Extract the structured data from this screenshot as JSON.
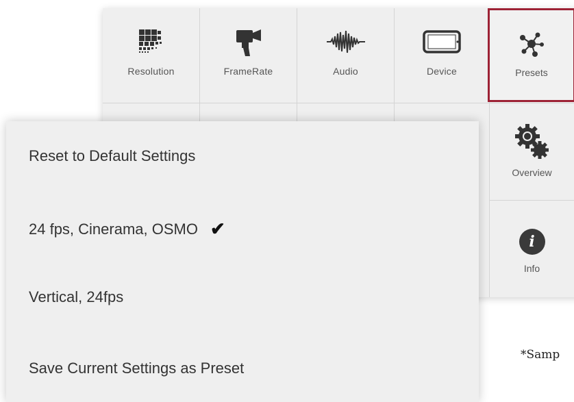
{
  "toolbar": {
    "tiles": [
      {
        "label": "Resolution",
        "icon": "resolution-grid-icon"
      },
      {
        "label": "FrameRate",
        "icon": "film-camera-icon"
      },
      {
        "label": "Audio",
        "icon": "audio-waveform-icon"
      },
      {
        "label": "Device",
        "icon": "device-phone-icon"
      },
      {
        "label": "Presets",
        "icon": "presets-molecule-icon",
        "selected": true
      }
    ],
    "side": [
      {
        "label": "Overview",
        "icon": "gears-icon"
      },
      {
        "label": "Info",
        "icon": "info-icon",
        "glyph": "i"
      }
    ]
  },
  "presets_menu": {
    "items": [
      {
        "label": "Reset to Default Settings",
        "checked": false
      },
      {
        "label": "24 fps, Cinerama, OSMO",
        "checked": true,
        "check_glyph": "✔"
      },
      {
        "label": "Vertical, 24fps",
        "checked": false
      },
      {
        "label": "Save Current Settings as Preset",
        "checked": false
      }
    ]
  },
  "footnote": "*Samp",
  "colors": {
    "selected_border": "#9d2235",
    "panel": "#efefef",
    "icon": "#333333"
  }
}
